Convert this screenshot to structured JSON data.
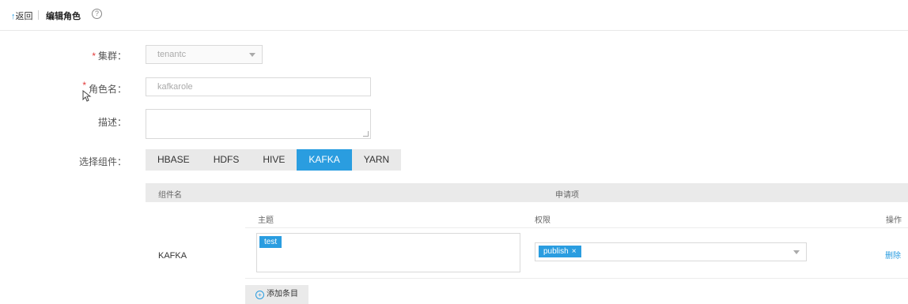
{
  "header": {
    "back_label": "返回",
    "back_arrow": "↑",
    "title": "编辑角色",
    "help_glyph": "?"
  },
  "form": {
    "cluster": {
      "label": "集群：",
      "required_mark": "*",
      "value": "tenantc"
    },
    "role_name": {
      "label": "角色名：",
      "required_mark": "*",
      "value": "kafkarole"
    },
    "description": {
      "label": "描述：",
      "value": ""
    },
    "components": {
      "label": "选择组件：",
      "tabs": [
        "HBASE",
        "HDFS",
        "HIVE",
        "KAFKA",
        "YARN"
      ],
      "active": "KAFKA"
    }
  },
  "table": {
    "header_col1": "组件名",
    "header_col2": "申请项",
    "sub_topic": "主题",
    "sub_permission": "权限",
    "sub_action": "操作",
    "row_component": "KAFKA",
    "topic_tag": "test",
    "permission_tag": "publish",
    "remove_glyph": "×",
    "delete_label": "删除",
    "add_label": "添加条目",
    "add_glyph": "+"
  },
  "colors": {
    "accent": "#2a9de0",
    "required": "#e23b3b"
  }
}
